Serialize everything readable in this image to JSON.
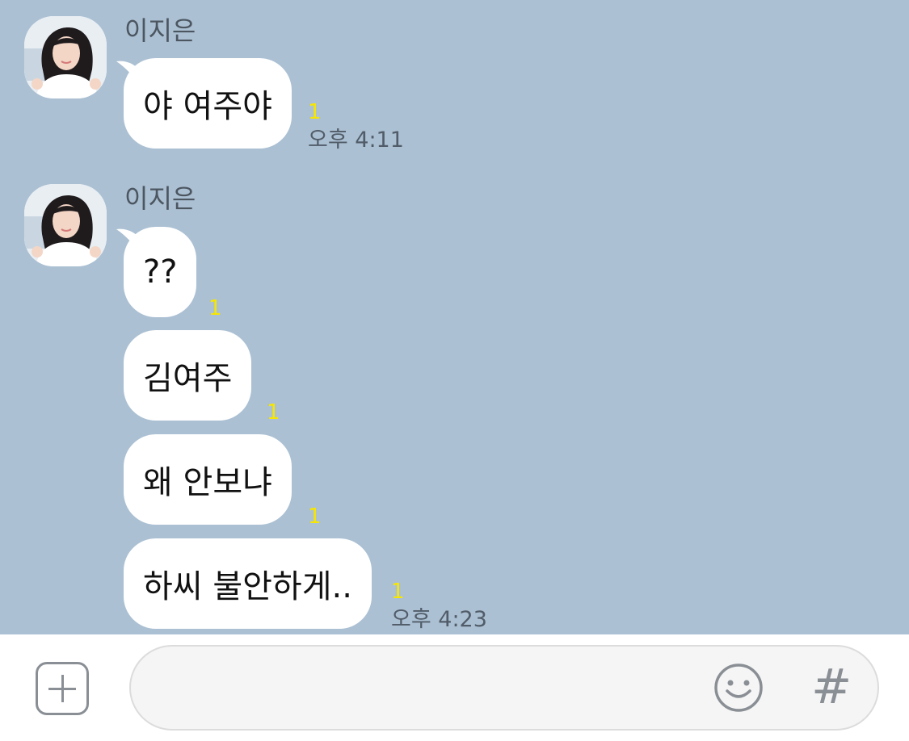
{
  "chat": {
    "background": "#abc0d3",
    "groups": [
      {
        "sender": "이지은",
        "avatar_icon": "profile-photo",
        "messages": [
          {
            "text": "야 여주야",
            "unread": "1",
            "time": "오후 4:11"
          }
        ]
      },
      {
        "sender": "이지은",
        "avatar_icon": "profile-photo",
        "messages": [
          {
            "text": "??",
            "unread": "1"
          },
          {
            "text": "김여주",
            "unread": "1"
          },
          {
            "text": "왜 안보냐",
            "unread": "1"
          },
          {
            "text": "하씨 불안하게..",
            "unread": "1",
            "time": "오후 4:23"
          }
        ]
      }
    ]
  },
  "input_bar": {
    "plus_icon": "plus-square-icon",
    "emoji_icon": "smiley-icon",
    "hash_label": "#",
    "message_value": ""
  },
  "colors": {
    "bubble": "#ffffff",
    "unread": "#f7e600",
    "meta_text": "#515c68"
  }
}
